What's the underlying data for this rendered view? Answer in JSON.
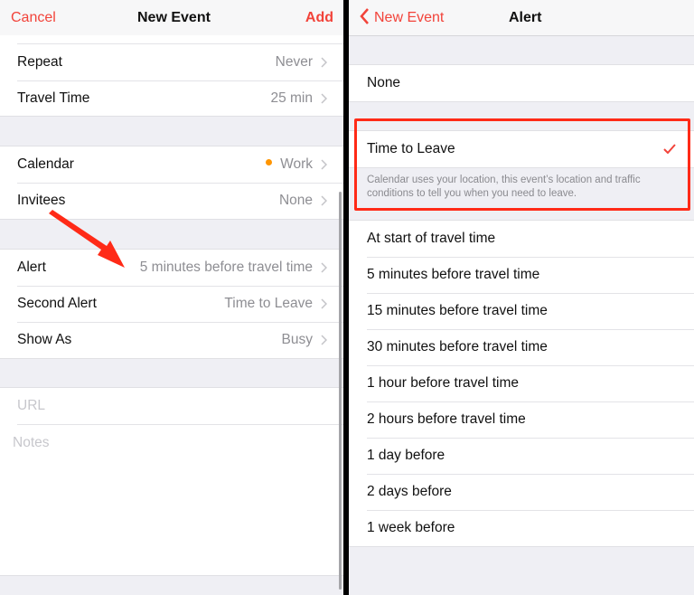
{
  "left_screen": {
    "header": {
      "cancel_label": "Cancel",
      "title": "New Event",
      "add_label": "Add"
    },
    "section_repeat": [
      {
        "label": "Repeat",
        "value": "Never"
      },
      {
        "label": "Travel Time",
        "value": "25 min"
      }
    ],
    "section_calendar": [
      {
        "label": "Calendar",
        "value": "Work",
        "dot_color": "#ff9500"
      },
      {
        "label": "Invitees",
        "value": "None"
      }
    ],
    "section_alert": [
      {
        "label": "Alert",
        "value": "5 minutes before travel time"
      },
      {
        "label": "Second Alert",
        "value": "Time to Leave"
      },
      {
        "label": "Show As",
        "value": "Busy"
      }
    ],
    "url_placeholder": "URL",
    "notes_placeholder": "Notes"
  },
  "right_screen": {
    "header": {
      "back_label": "New Event",
      "title": "Alert"
    },
    "none_option": "None",
    "time_to_leave": {
      "label": "Time to Leave",
      "selected": true,
      "footer": "Calendar uses your location, this event’s location and traffic conditions to tell you when you need to leave."
    },
    "options": [
      "At start of travel time",
      "5 minutes before travel time",
      "15 minutes before travel time",
      "30 minutes before travel time",
      "1 hour before travel time",
      "2 hours before travel time",
      "1 day before",
      "2 days before",
      "1 week before"
    ]
  },
  "colors": {
    "accent": "#f2433a",
    "annotation": "#ff2a17",
    "calendar_dot": "#ff9500"
  }
}
